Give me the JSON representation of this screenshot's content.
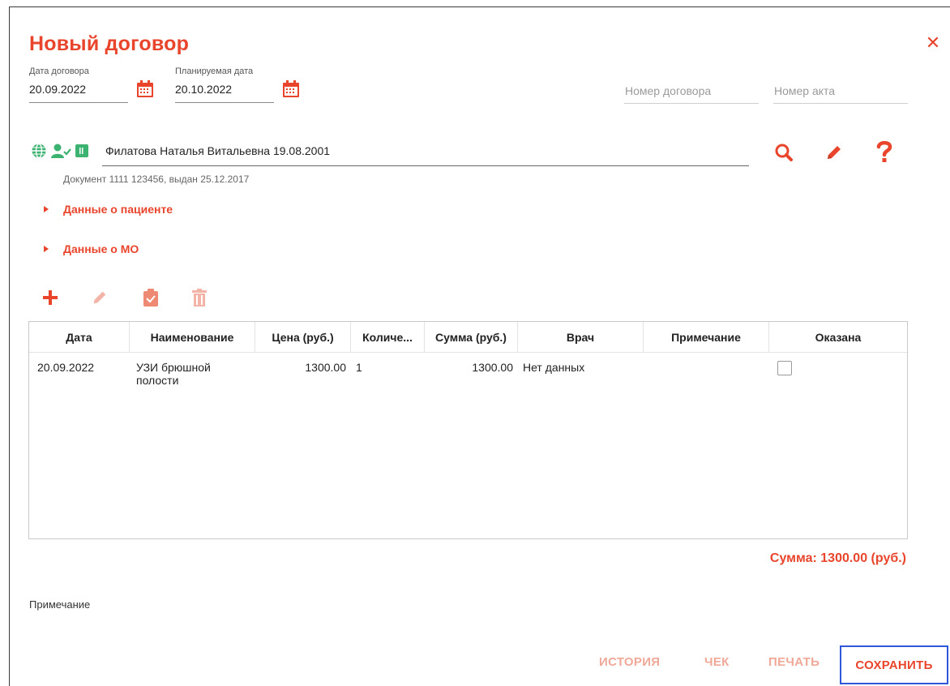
{
  "dialog": {
    "title": "Новый договор",
    "close_icon": "close-icon"
  },
  "contract": {
    "date_label": "Дата договора",
    "date_value": "20.09.2022",
    "planned_label": "Планируемая дата",
    "planned_value": "20.10.2022",
    "number_placeholder": "Номер договора",
    "act_placeholder": "Номер акта"
  },
  "patient": {
    "name": "Филатова Наталья Витальевна 19.08.2001",
    "document": "Документ 1111 123456, выдан 25.12.2017",
    "icons": [
      "globe-icon",
      "user-check-icon",
      "card-icon"
    ],
    "actions": [
      "search-icon",
      "pencil-icon",
      "help-icon"
    ]
  },
  "sections": {
    "patient_data": "Данные о пациенте",
    "mo_data": "Данные о МО"
  },
  "toolbar": {
    "icons": [
      "add-icon",
      "edit-icon",
      "clipboard-check-icon",
      "trash-icon"
    ]
  },
  "table": {
    "columns": [
      "Дата",
      "Наименование",
      "Цена (руб.)",
      "Количе...",
      "Сумма (руб.)",
      "Врач",
      "Примечание",
      "Оказана"
    ],
    "rows": [
      {
        "date": "20.09.2022",
        "name": "УЗИ брюшной полости",
        "price": "1300.00",
        "qty": "1",
        "sum": "1300.00",
        "doctor": "Нет данных",
        "note": "",
        "provided": false
      }
    ]
  },
  "total": "Сумма: 1300.00 (руб.)",
  "note_label": "Примечание",
  "footer": {
    "history": "ИСТОРИЯ",
    "receipt": "ЧЕК",
    "print": "ПЕЧАТЬ",
    "save": "СОХРАНИТЬ"
  },
  "colors": {
    "accent": "#e8452c",
    "accent_disabled": "#f0a898",
    "green": "#3cb371",
    "focus_border": "#2f57d9"
  }
}
